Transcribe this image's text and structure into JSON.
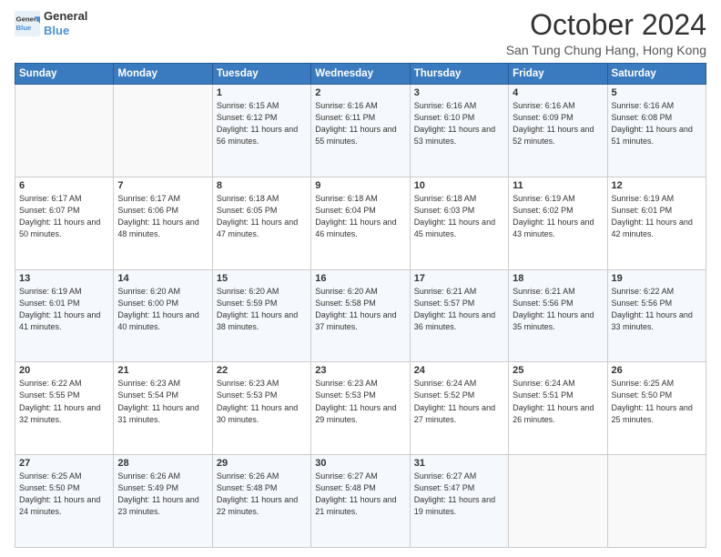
{
  "logo": {
    "line1": "General",
    "line2": "Blue"
  },
  "title": "October 2024",
  "subtitle": "San Tung Chung Hang, Hong Kong",
  "days_of_week": [
    "Sunday",
    "Monday",
    "Tuesday",
    "Wednesday",
    "Thursday",
    "Friday",
    "Saturday"
  ],
  "weeks": [
    [
      {
        "day": "",
        "info": ""
      },
      {
        "day": "",
        "info": ""
      },
      {
        "day": "1",
        "info": "Sunrise: 6:15 AM\nSunset: 6:12 PM\nDaylight: 11 hours and 56 minutes."
      },
      {
        "day": "2",
        "info": "Sunrise: 6:16 AM\nSunset: 6:11 PM\nDaylight: 11 hours and 55 minutes."
      },
      {
        "day": "3",
        "info": "Sunrise: 6:16 AM\nSunset: 6:10 PM\nDaylight: 11 hours and 53 minutes."
      },
      {
        "day": "4",
        "info": "Sunrise: 6:16 AM\nSunset: 6:09 PM\nDaylight: 11 hours and 52 minutes."
      },
      {
        "day": "5",
        "info": "Sunrise: 6:16 AM\nSunset: 6:08 PM\nDaylight: 11 hours and 51 minutes."
      }
    ],
    [
      {
        "day": "6",
        "info": "Sunrise: 6:17 AM\nSunset: 6:07 PM\nDaylight: 11 hours and 50 minutes."
      },
      {
        "day": "7",
        "info": "Sunrise: 6:17 AM\nSunset: 6:06 PM\nDaylight: 11 hours and 48 minutes."
      },
      {
        "day": "8",
        "info": "Sunrise: 6:18 AM\nSunset: 6:05 PM\nDaylight: 11 hours and 47 minutes."
      },
      {
        "day": "9",
        "info": "Sunrise: 6:18 AM\nSunset: 6:04 PM\nDaylight: 11 hours and 46 minutes."
      },
      {
        "day": "10",
        "info": "Sunrise: 6:18 AM\nSunset: 6:03 PM\nDaylight: 11 hours and 45 minutes."
      },
      {
        "day": "11",
        "info": "Sunrise: 6:19 AM\nSunset: 6:02 PM\nDaylight: 11 hours and 43 minutes."
      },
      {
        "day": "12",
        "info": "Sunrise: 6:19 AM\nSunset: 6:01 PM\nDaylight: 11 hours and 42 minutes."
      }
    ],
    [
      {
        "day": "13",
        "info": "Sunrise: 6:19 AM\nSunset: 6:01 PM\nDaylight: 11 hours and 41 minutes."
      },
      {
        "day": "14",
        "info": "Sunrise: 6:20 AM\nSunset: 6:00 PM\nDaylight: 11 hours and 40 minutes."
      },
      {
        "day": "15",
        "info": "Sunrise: 6:20 AM\nSunset: 5:59 PM\nDaylight: 11 hours and 38 minutes."
      },
      {
        "day": "16",
        "info": "Sunrise: 6:20 AM\nSunset: 5:58 PM\nDaylight: 11 hours and 37 minutes."
      },
      {
        "day": "17",
        "info": "Sunrise: 6:21 AM\nSunset: 5:57 PM\nDaylight: 11 hours and 36 minutes."
      },
      {
        "day": "18",
        "info": "Sunrise: 6:21 AM\nSunset: 5:56 PM\nDaylight: 11 hours and 35 minutes."
      },
      {
        "day": "19",
        "info": "Sunrise: 6:22 AM\nSunset: 5:56 PM\nDaylight: 11 hours and 33 minutes."
      }
    ],
    [
      {
        "day": "20",
        "info": "Sunrise: 6:22 AM\nSunset: 5:55 PM\nDaylight: 11 hours and 32 minutes."
      },
      {
        "day": "21",
        "info": "Sunrise: 6:23 AM\nSunset: 5:54 PM\nDaylight: 11 hours and 31 minutes."
      },
      {
        "day": "22",
        "info": "Sunrise: 6:23 AM\nSunset: 5:53 PM\nDaylight: 11 hours and 30 minutes."
      },
      {
        "day": "23",
        "info": "Sunrise: 6:23 AM\nSunset: 5:53 PM\nDaylight: 11 hours and 29 minutes."
      },
      {
        "day": "24",
        "info": "Sunrise: 6:24 AM\nSunset: 5:52 PM\nDaylight: 11 hours and 27 minutes."
      },
      {
        "day": "25",
        "info": "Sunrise: 6:24 AM\nSunset: 5:51 PM\nDaylight: 11 hours and 26 minutes."
      },
      {
        "day": "26",
        "info": "Sunrise: 6:25 AM\nSunset: 5:50 PM\nDaylight: 11 hours and 25 minutes."
      }
    ],
    [
      {
        "day": "27",
        "info": "Sunrise: 6:25 AM\nSunset: 5:50 PM\nDaylight: 11 hours and 24 minutes."
      },
      {
        "day": "28",
        "info": "Sunrise: 6:26 AM\nSunset: 5:49 PM\nDaylight: 11 hours and 23 minutes."
      },
      {
        "day": "29",
        "info": "Sunrise: 6:26 AM\nSunset: 5:48 PM\nDaylight: 11 hours and 22 minutes."
      },
      {
        "day": "30",
        "info": "Sunrise: 6:27 AM\nSunset: 5:48 PM\nDaylight: 11 hours and 21 minutes."
      },
      {
        "day": "31",
        "info": "Sunrise: 6:27 AM\nSunset: 5:47 PM\nDaylight: 11 hours and 19 minutes."
      },
      {
        "day": "",
        "info": ""
      },
      {
        "day": "",
        "info": ""
      }
    ]
  ]
}
